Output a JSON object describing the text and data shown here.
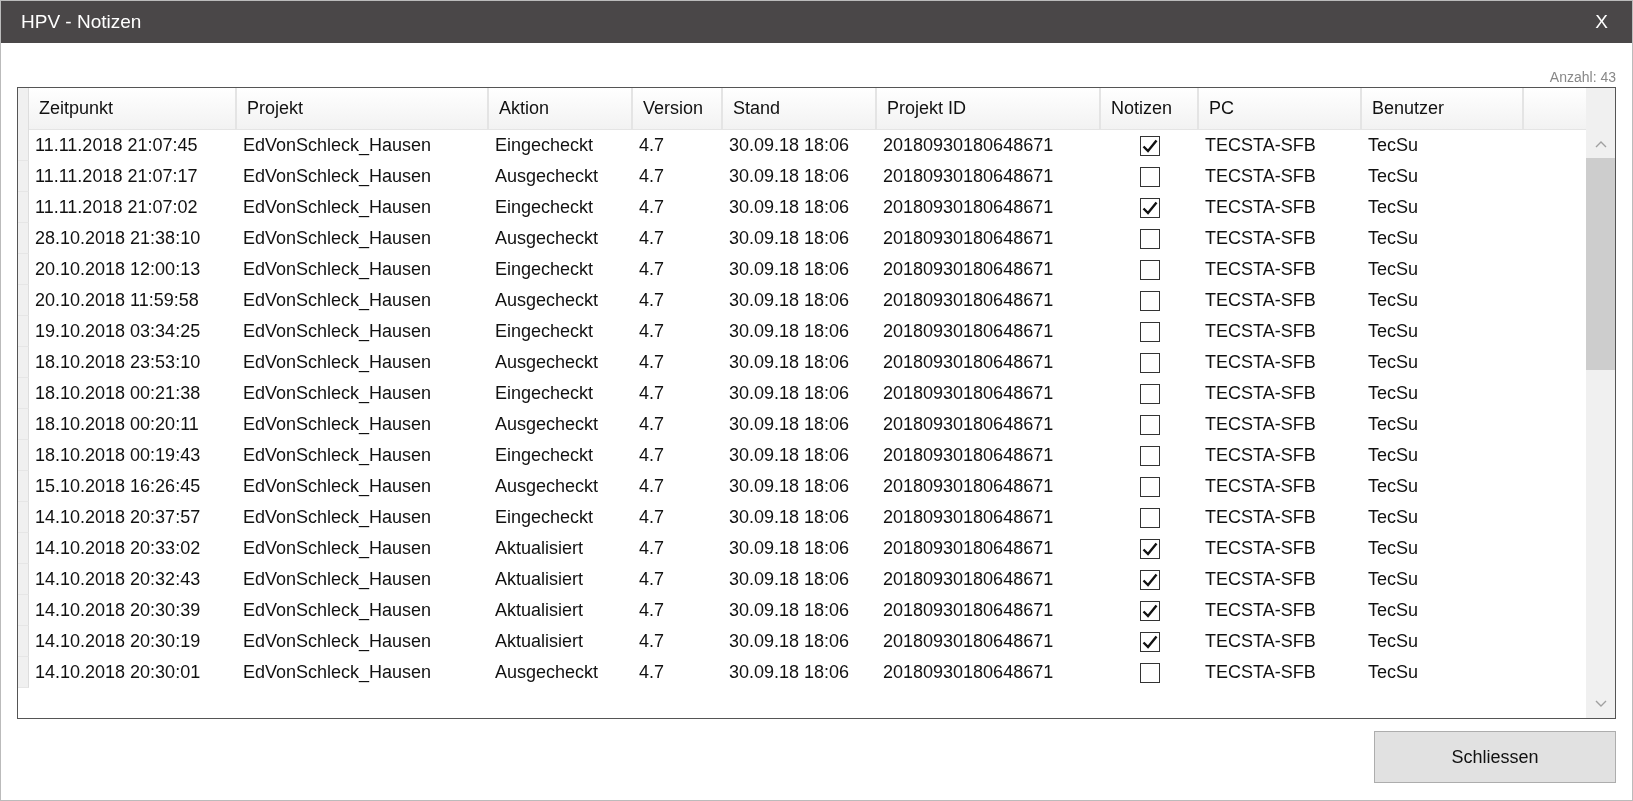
{
  "window": {
    "title": "HPV - Notizen",
    "close": "X"
  },
  "count": "Anzahl: 43",
  "table": {
    "columns": [
      "Zeitpunkt",
      "Projekt",
      "Aktion",
      "Version",
      "Stand",
      "Projekt ID",
      "Notizen",
      "PC",
      "Benutzer"
    ],
    "rows": [
      {
        "time": "11.11.2018 21:07:45",
        "project": "EdVonSchleck_Hausen",
        "action": "Eingecheckt",
        "version": "4.7",
        "stand": "30.09.18 18:06",
        "project_id": "20180930180648671",
        "notes": true,
        "pc": "TECSTA-SFB",
        "user": "TecSu"
      },
      {
        "time": "11.11.2018 21:07:17",
        "project": "EdVonSchleck_Hausen",
        "action": "Ausgecheckt",
        "version": "4.7",
        "stand": "30.09.18 18:06",
        "project_id": "20180930180648671",
        "notes": false,
        "pc": "TECSTA-SFB",
        "user": "TecSu"
      },
      {
        "time": "11.11.2018 21:07:02",
        "project": "EdVonSchleck_Hausen",
        "action": "Eingecheckt",
        "version": "4.7",
        "stand": "30.09.18 18:06",
        "project_id": "20180930180648671",
        "notes": true,
        "pc": "TECSTA-SFB",
        "user": "TecSu"
      },
      {
        "time": "28.10.2018 21:38:10",
        "project": "EdVonSchleck_Hausen",
        "action": "Ausgecheckt",
        "version": "4.7",
        "stand": "30.09.18 18:06",
        "project_id": "20180930180648671",
        "notes": false,
        "pc": "TECSTA-SFB",
        "user": "TecSu"
      },
      {
        "time": "20.10.2018 12:00:13",
        "project": "EdVonSchleck_Hausen",
        "action": "Eingecheckt",
        "version": "4.7",
        "stand": "30.09.18 18:06",
        "project_id": "20180930180648671",
        "notes": false,
        "pc": "TECSTA-SFB",
        "user": "TecSu"
      },
      {
        "time": "20.10.2018 11:59:58",
        "project": "EdVonSchleck_Hausen",
        "action": "Ausgecheckt",
        "version": "4.7",
        "stand": "30.09.18 18:06",
        "project_id": "20180930180648671",
        "notes": false,
        "pc": "TECSTA-SFB",
        "user": "TecSu"
      },
      {
        "time": "19.10.2018 03:34:25",
        "project": "EdVonSchleck_Hausen",
        "action": "Eingecheckt",
        "version": "4.7",
        "stand": "30.09.18 18:06",
        "project_id": "20180930180648671",
        "notes": false,
        "pc": "TECSTA-SFB",
        "user": "TecSu"
      },
      {
        "time": "18.10.2018 23:53:10",
        "project": "EdVonSchleck_Hausen",
        "action": "Ausgecheckt",
        "version": "4.7",
        "stand": "30.09.18 18:06",
        "project_id": "20180930180648671",
        "notes": false,
        "pc": "TECSTA-SFB",
        "user": "TecSu"
      },
      {
        "time": "18.10.2018 00:21:38",
        "project": "EdVonSchleck_Hausen",
        "action": "Eingecheckt",
        "version": "4.7",
        "stand": "30.09.18 18:06",
        "project_id": "20180930180648671",
        "notes": false,
        "pc": "TECSTA-SFB",
        "user": "TecSu"
      },
      {
        "time": "18.10.2018 00:20:11",
        "project": "EdVonSchleck_Hausen",
        "action": "Ausgecheckt",
        "version": "4.7",
        "stand": "30.09.18 18:06",
        "project_id": "20180930180648671",
        "notes": false,
        "pc": "TECSTA-SFB",
        "user": "TecSu"
      },
      {
        "time": "18.10.2018 00:19:43",
        "project": "EdVonSchleck_Hausen",
        "action": "Eingecheckt",
        "version": "4.7",
        "stand": "30.09.18 18:06",
        "project_id": "20180930180648671",
        "notes": false,
        "pc": "TECSTA-SFB",
        "user": "TecSu"
      },
      {
        "time": "15.10.2018 16:26:45",
        "project": "EdVonSchleck_Hausen",
        "action": "Ausgecheckt",
        "version": "4.7",
        "stand": "30.09.18 18:06",
        "project_id": "20180930180648671",
        "notes": false,
        "pc": "TECSTA-SFB",
        "user": "TecSu"
      },
      {
        "time": "14.10.2018 20:37:57",
        "project": "EdVonSchleck_Hausen",
        "action": "Eingecheckt",
        "version": "4.7",
        "stand": "30.09.18 18:06",
        "project_id": "20180930180648671",
        "notes": false,
        "pc": "TECSTA-SFB",
        "user": "TecSu"
      },
      {
        "time": "14.10.2018 20:33:02",
        "project": "EdVonSchleck_Hausen",
        "action": "Aktualisiert",
        "version": "4.7",
        "stand": "30.09.18 18:06",
        "project_id": "20180930180648671",
        "notes": true,
        "pc": "TECSTA-SFB",
        "user": "TecSu"
      },
      {
        "time": "14.10.2018 20:32:43",
        "project": "EdVonSchleck_Hausen",
        "action": "Aktualisiert",
        "version": "4.7",
        "stand": "30.09.18 18:06",
        "project_id": "20180930180648671",
        "notes": true,
        "pc": "TECSTA-SFB",
        "user": "TecSu"
      },
      {
        "time": "14.10.2018 20:30:39",
        "project": "EdVonSchleck_Hausen",
        "action": "Aktualisiert",
        "version": "4.7",
        "stand": "30.09.18 18:06",
        "project_id": "20180930180648671",
        "notes": true,
        "pc": "TECSTA-SFB",
        "user": "TecSu"
      },
      {
        "time": "14.10.2018 20:30:19",
        "project": "EdVonSchleck_Hausen",
        "action": "Aktualisiert",
        "version": "4.7",
        "stand": "30.09.18 18:06",
        "project_id": "20180930180648671",
        "notes": true,
        "pc": "TECSTA-SFB",
        "user": "TecSu"
      },
      {
        "time": "14.10.2018 20:30:01",
        "project": "EdVonSchleck_Hausen",
        "action": "Ausgecheckt",
        "version": "4.7",
        "stand": "30.09.18 18:06",
        "project_id": "20180930180648671",
        "notes": false,
        "pc": "TECSTA-SFB",
        "user": "TecSu"
      }
    ]
  },
  "buttons": [
    "Schliessen"
  ]
}
